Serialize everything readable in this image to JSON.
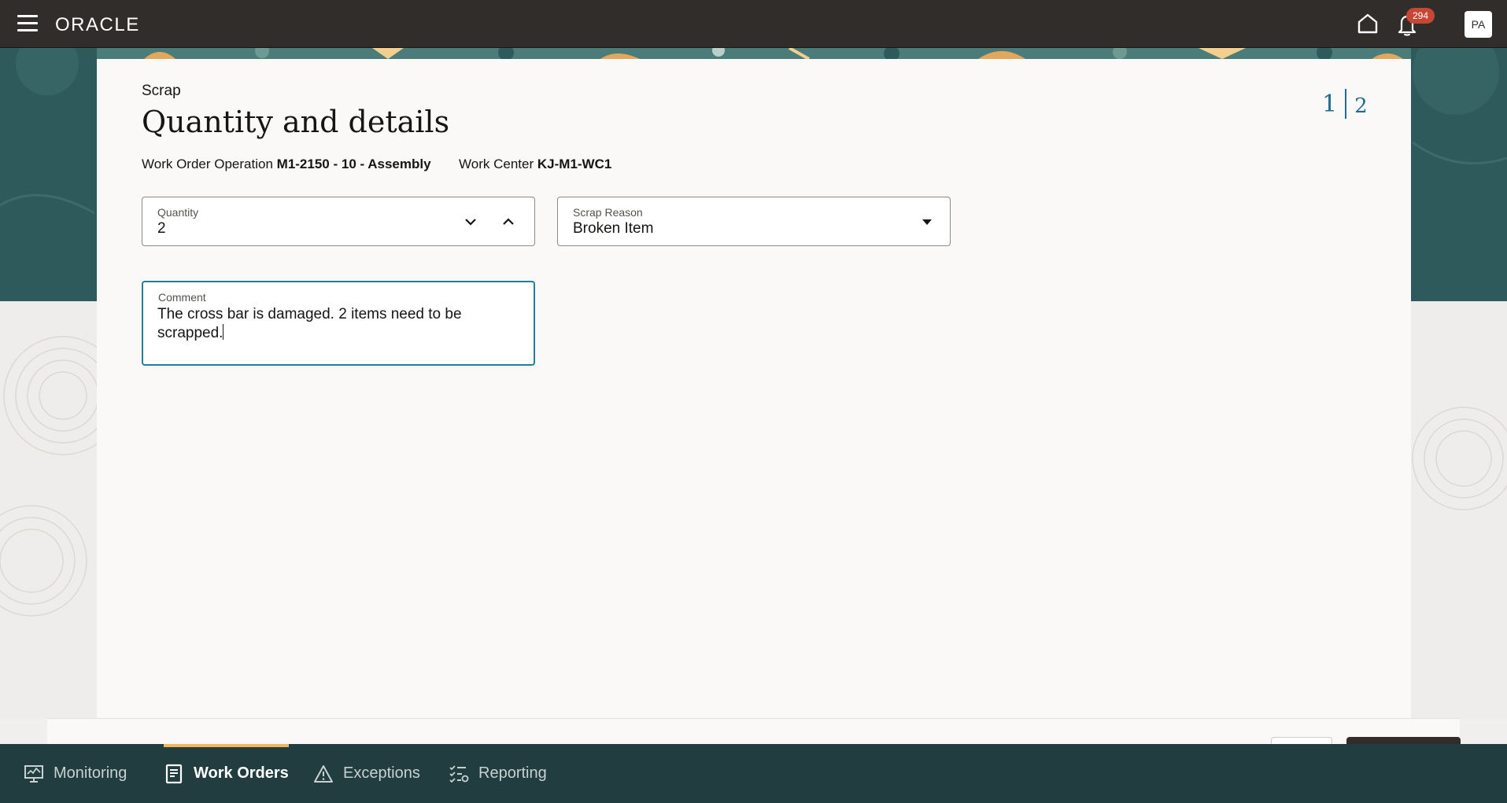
{
  "header": {
    "logo_text": "ORACLE",
    "notification_count": "294",
    "avatar_initials": "PA"
  },
  "page": {
    "overline": "Scrap",
    "title": "Quantity and details",
    "context": {
      "work_order_operation_label": "Work Order Operation",
      "work_order_operation_value": "M1-2150 - 10 - Assembly",
      "work_center_label": "Work Center",
      "work_center_value": "KJ-M1-WC1"
    },
    "step": {
      "current": "1",
      "total": "2"
    }
  },
  "form": {
    "quantity": {
      "label": "Quantity",
      "value": "2"
    },
    "scrap_reason": {
      "label": "Scrap Reason",
      "value": "Broken Item"
    },
    "comment": {
      "label": "Comment",
      "value": "The cross bar is damaged. 2 items need to be scrapped."
    }
  },
  "bottom_nav": {
    "items": [
      {
        "label": "Monitoring",
        "icon": "monitor-icon",
        "active": false
      },
      {
        "label": "Work Orders",
        "icon": "document-icon",
        "active": true
      },
      {
        "label": "Exceptions",
        "icon": "warning-icon",
        "active": false
      },
      {
        "label": "Reporting",
        "icon": "checklist-icon",
        "active": false
      }
    ]
  },
  "colors": {
    "header_bg": "#312d2a",
    "teal_band": "#2e5a5c",
    "bottom_nav_bg": "#223d3f",
    "accent_blue": "#1f6c8f",
    "active_tab_indicator": "#f0b85a",
    "badge": "#c74634"
  }
}
